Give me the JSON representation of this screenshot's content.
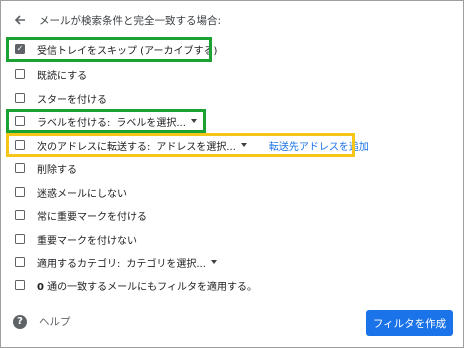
{
  "header": {
    "title": "メールが検索条件と完全一致する場合:"
  },
  "options": [
    {
      "label": "受信トレイをスキップ (アーカイブする)",
      "checked": true
    },
    {
      "label": "既読にする",
      "checked": false
    },
    {
      "label": "スターを付ける",
      "checked": false
    },
    {
      "label": "ラベルを付ける:",
      "dropdown": "ラベルを選択...",
      "checked": false
    },
    {
      "label": "次のアドレスに転送する:",
      "dropdown": "アドレスを選択...",
      "link": "転送先アドレスを追加",
      "checked": false
    },
    {
      "label": "削除する",
      "checked": false
    },
    {
      "label": "迷惑メールにしない",
      "checked": false
    },
    {
      "label": "常に重要マークを付ける",
      "checked": false
    },
    {
      "label": "重要マークを付けない",
      "checked": false
    },
    {
      "label": "適用するカテゴリ:",
      "dropdown": "カテゴリを選択...",
      "checked": false
    },
    {
      "count": "0",
      "label": "通の一致するメールにもフィルタを適用する。",
      "checked": false
    }
  ],
  "footer": {
    "help_label": "ヘルプ",
    "help_icon_glyph": "?",
    "create_button": "フィルタを作成"
  },
  "colors": {
    "highlight_green": "#1aa333",
    "highlight_yellow": "#f5c518",
    "primary_button": "#1a73e8"
  }
}
